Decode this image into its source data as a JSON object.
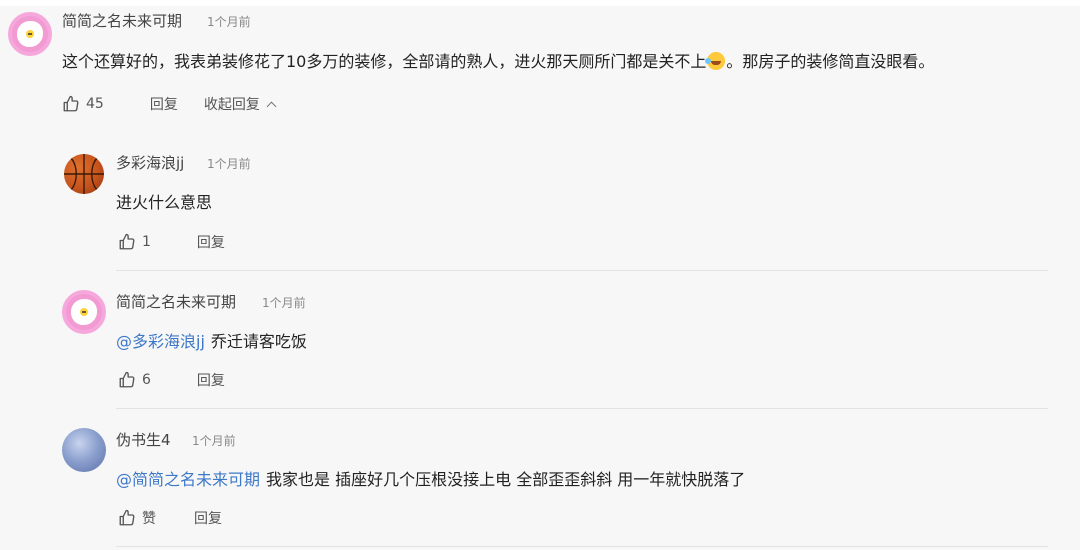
{
  "comments": [
    {
      "author": "简简之名未来可期",
      "time": "1个月前",
      "text_before": "这个还算好的，我表弟装修花了10多万的装修，全部请的熟人，进火那天厕所门都是关不上",
      "text_after": "。那房子的装修简直没眼看。",
      "emoji_icon": "rofl-emoji-icon",
      "likes": "45",
      "reply_label": "回复",
      "collapse_label": "收起回复"
    }
  ],
  "replies": [
    {
      "author": "多彩海浪jj",
      "time": "1个月前",
      "mention": "",
      "text": "进火什么意思",
      "likes": "1",
      "reply_label": "回复"
    },
    {
      "author": "简简之名未来可期",
      "time": "1个月前",
      "mention": "@多彩海浪jj",
      "text": "乔迁请客吃饭",
      "likes": "6",
      "reply_label": "回复"
    },
    {
      "author": "伪书生4",
      "time": "1个月前",
      "mention": "@简简之名未来可期",
      "text": "我家也是 插座好几个压根没接上电 全部歪歪斜斜 用一年就快脱落了",
      "likes": "赞",
      "reply_label": "回复"
    }
  ],
  "colors": {
    "mention": "#3e78c9",
    "background": "#f7f7f7",
    "avatar_pink": "#f29ad2"
  }
}
